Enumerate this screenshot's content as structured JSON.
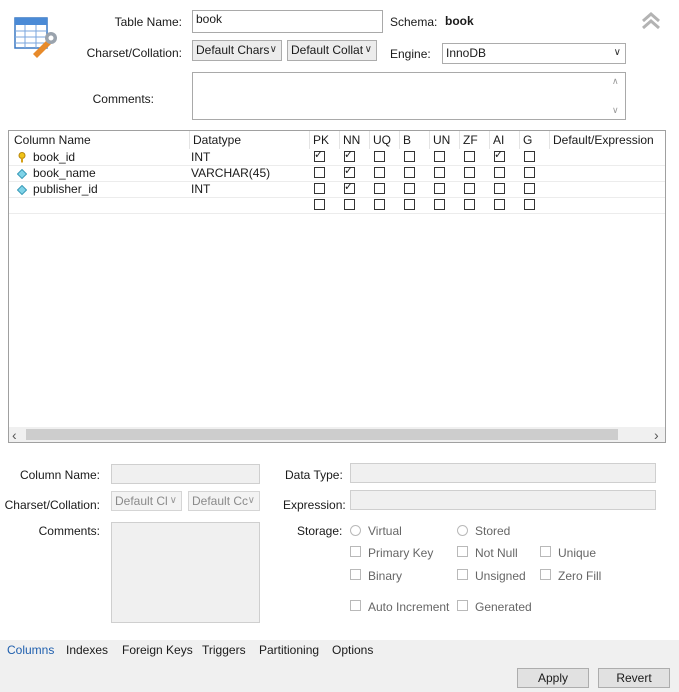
{
  "header": {
    "table_name_label": "Table Name:",
    "table_name_value": "book",
    "schema_label": "Schema:",
    "schema_value": "book",
    "charset_label": "Charset/Collation:",
    "charset_value": "Default Chars",
    "collation_value": "Default Collat",
    "engine_label": "Engine:",
    "engine_value": "InnoDB",
    "comments_label": "Comments:",
    "comments_value": ""
  },
  "grid": {
    "headers": [
      "Column Name",
      "Datatype",
      "PK",
      "NN",
      "UQ",
      "B",
      "UN",
      "ZF",
      "AI",
      "G",
      "Default/Expression"
    ],
    "rows": [
      {
        "icon": "primary-key-icon",
        "name": "book_id",
        "type": "INT",
        "flags": [
          true,
          true,
          false,
          false,
          false,
          false,
          true,
          false
        ],
        "default": ""
      },
      {
        "icon": "column-diamond-icon",
        "name": "book_name",
        "type": "VARCHAR(45)",
        "flags": [
          false,
          true,
          false,
          false,
          false,
          false,
          false,
          false
        ],
        "default": ""
      },
      {
        "icon": "column-diamond-icon",
        "name": "publisher_id",
        "type": "INT",
        "flags": [
          false,
          true,
          false,
          false,
          false,
          false,
          false,
          false
        ],
        "default": ""
      },
      {
        "icon": "",
        "name": "",
        "type": "",
        "flags": [
          false,
          false,
          false,
          false,
          false,
          false,
          false,
          false
        ],
        "default": ""
      }
    ],
    "scroll_left": "‹",
    "scroll_right": "›"
  },
  "details": {
    "column_name_label": "Column Name:",
    "charset_label": "Charset/Collation:",
    "charset_value": "Default Cl",
    "collation_value": "Default Cc",
    "comments_label": "Comments:",
    "data_type_label": "Data Type:",
    "expression_label": "Expression:",
    "storage_label": "Storage:",
    "virtual": "Virtual",
    "stored": "Stored",
    "primary_key": "Primary Key",
    "not_null": "Not Null",
    "unique": "Unique",
    "binary": "Binary",
    "unsigned": "Unsigned",
    "zero_fill": "Zero Fill",
    "auto_increment": "Auto Increment",
    "generated": "Generated"
  },
  "tabs": [
    "Columns",
    "Indexes",
    "Foreign Keys",
    "Triggers",
    "Partitioning",
    "Options"
  ],
  "buttons": {
    "apply": "Apply",
    "revert": "Revert"
  },
  "colors": {
    "accent": "#1f5fae",
    "tabbar": "#f0f0f0",
    "scrollbar": "#cdcdcd"
  }
}
